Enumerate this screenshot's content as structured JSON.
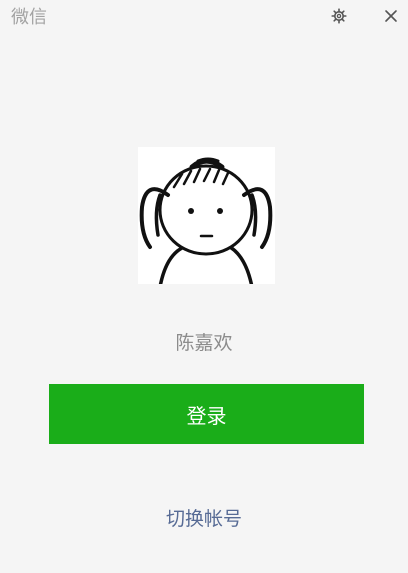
{
  "window": {
    "title": "微信",
    "icons": {
      "settings": "gear-icon",
      "close": "close-icon"
    }
  },
  "profile": {
    "username": "陈嘉欢",
    "avatar": "cartoon-face-avatar"
  },
  "actions": {
    "login_label": "登录",
    "switch_account_label": "切换帐号"
  },
  "colors": {
    "background": "#f5f5f5",
    "login_button": "#1aad19",
    "link": "#576b95",
    "muted_text": "#a3a3a3"
  }
}
